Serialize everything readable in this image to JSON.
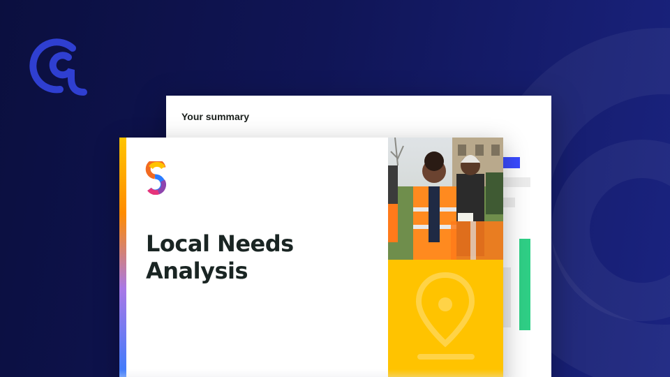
{
  "back_card": {
    "title": "Your summary"
  },
  "front_card": {
    "title_line1": "Local Needs",
    "title_line2": "Analysis"
  },
  "colors": {
    "background_dark": "#0b0f3f",
    "brand_blue": "#2f3fd1",
    "yellow": "#ffc300",
    "green": "#2fcf86",
    "blue_accent": "#3a4bff",
    "title_text": "#1a2523"
  },
  "icons": {
    "brand": "c-ring-logo-icon",
    "org": "s-multicolor-logo-icon",
    "location": "map-pin-icon"
  }
}
